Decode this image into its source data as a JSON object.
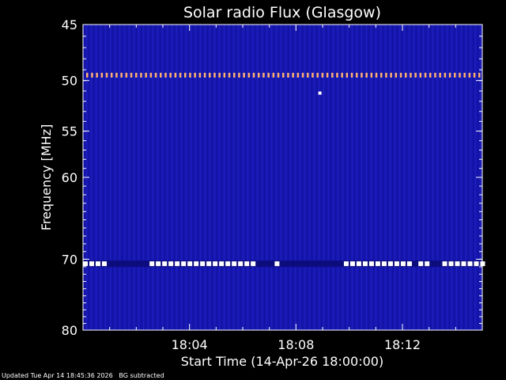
{
  "footer": {
    "updated": "Updated Tue Apr 14 18:45:36 2026",
    "note": "BG subtracted"
  },
  "chart_data": {
    "type": "heatmap",
    "title": "Solar radio Flux (Glasgow)",
    "xlabel": "Start Time (14-Apr-26 18:00:00)",
    "ylabel": "Frequency [MHz]",
    "x_ticks": [
      "18:04",
      "18:08",
      "18:12"
    ],
    "x_tick_minutes": [
      4,
      8,
      12
    ],
    "xlim_minutes": [
      0,
      15
    ],
    "y_ticks": [
      45,
      50,
      55,
      60,
      70,
      80
    ],
    "ylim": [
      45,
      80
    ],
    "y_scale": "log",
    "background_color": "#1a1ab4",
    "features": [
      {
        "kind": "dotted-band",
        "freq_mhz": 49.5,
        "t_start": 0,
        "t_end": 15,
        "color": "#ffb070"
      },
      {
        "kind": "dotted-band",
        "freq_mhz": 70.6,
        "t_start": 0,
        "t_end": 15,
        "color": "#ffffff"
      },
      {
        "kind": "point",
        "freq_mhz": 51.2,
        "t": 8.9,
        "color": "#ffffff"
      }
    ],
    "band_segments_70mhz": [
      [
        0.0,
        0.8
      ],
      [
        2.5,
        6.5
      ],
      [
        7.2,
        7.3
      ],
      [
        9.8,
        12.3
      ],
      [
        12.6,
        13.0
      ],
      [
        13.5,
        15.0
      ]
    ]
  }
}
